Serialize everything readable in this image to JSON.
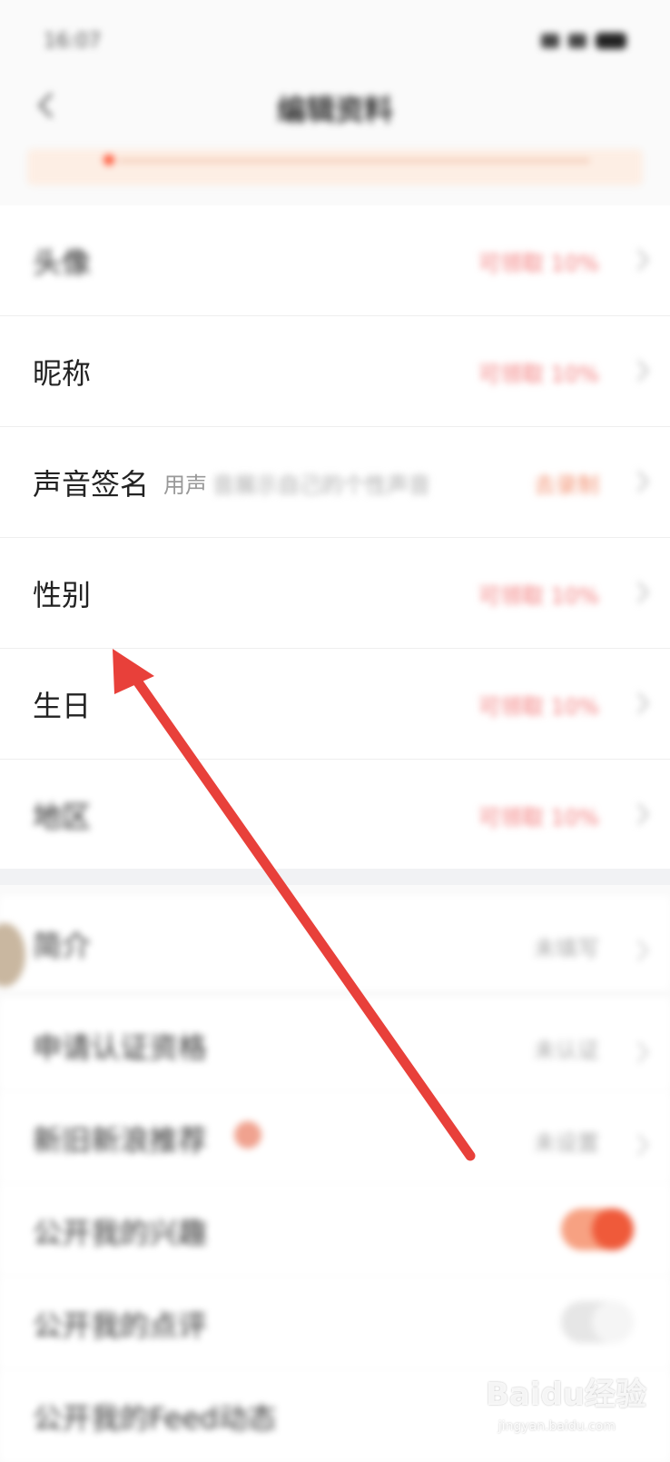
{
  "status_bar": {
    "time": "16:07"
  },
  "nav": {
    "title": "编辑资料"
  },
  "profile_rows": [
    {
      "label": "头像",
      "value": "可领取 10%"
    },
    {
      "label": "昵称",
      "value": "可领取 10%"
    },
    {
      "label": "声音签名",
      "hint_visible": "用声",
      "hint_blurred": "音展示自己的个性声音",
      "value": "去录制"
    },
    {
      "label": "性别",
      "value": "可领取 10%"
    },
    {
      "label": "生日",
      "value": "可领取 10%"
    },
    {
      "label": "地区",
      "value": "可领取 10%"
    }
  ],
  "settings_rows": [
    {
      "label": "简介",
      "value": "未填写"
    },
    {
      "label": "申请认证资格",
      "value": "未认证"
    },
    {
      "label": "新旧新浪推荐",
      "value": "未设置"
    },
    {
      "label": "公开我的兴趣",
      "toggle_on": true
    },
    {
      "label": "公开我的点评",
      "toggle_on": false
    },
    {
      "label": "公开我的Feed动态"
    }
  ],
  "watermark": {
    "brand": "Baidu经验",
    "url": "jingyan.baidu.com"
  },
  "colors": {
    "accent": "#ef5a3a",
    "arrow": "#e8403a",
    "value_red": "#f27a7a"
  },
  "icons": {
    "back": "chevron-left-icon",
    "row_arrow": "chevron-right-icon"
  }
}
